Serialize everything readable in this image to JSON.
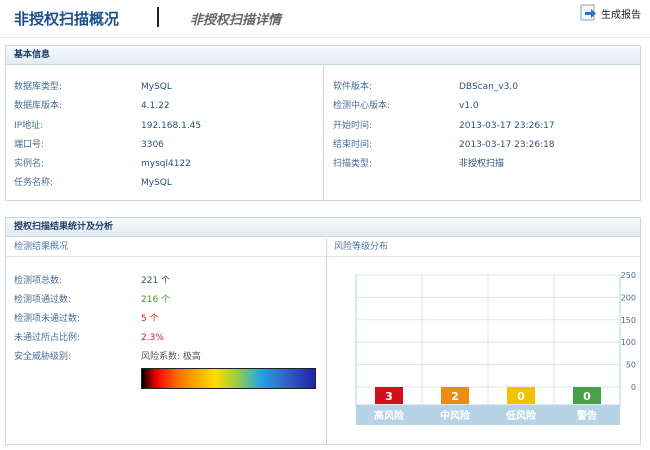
{
  "tabs": {
    "active": "非授权扫描概况",
    "inactive": "非授权扫描详情"
  },
  "toolbar": {
    "report_label": "生成报告"
  },
  "basic": {
    "title": "基本信息",
    "left": [
      {
        "label": "数据库类型:",
        "value": "MySQL"
      },
      {
        "label": "数据库版本:",
        "value": "4.1.22"
      },
      {
        "label": "IP地址:",
        "value": "192.168.1.45"
      },
      {
        "label": "端口号:",
        "value": "3306"
      },
      {
        "label": "实例名:",
        "value": "mysql4122"
      },
      {
        "label": "任务名称:",
        "value": "MySQL"
      }
    ],
    "right": [
      {
        "label": "软件版本:",
        "value": "DBScan_v3.0"
      },
      {
        "label": "检测中心版本:",
        "value": "v1.0"
      },
      {
        "label": "开始时间:",
        "value": "2013-03-17 23:26:17"
      },
      {
        "label": "结束时间:",
        "value": "2013-03-17 23:26:18"
      },
      {
        "label": "扫描类型:",
        "value": "非授权扫描"
      }
    ]
  },
  "analysis": {
    "title": "授权扫描结果统计及分析",
    "overview_title": "检测结果概况",
    "risk_title": "风险等级分布",
    "stats": [
      {
        "label": "检测项总数:",
        "value": "221 个"
      },
      {
        "label": "检测项通过数:",
        "value": "216 个"
      },
      {
        "label": "检测项未通过数:",
        "value": "5 个"
      },
      {
        "label": "未通过所占比例:",
        "value": "2.3%"
      },
      {
        "label": "安全威胁级别:",
        "value": "风险系数: 极高"
      }
    ],
    "colors": {
      "pass": "#3b9b2b",
      "fail": "#d42020"
    }
  },
  "chart_data": {
    "type": "bar",
    "categories": [
      "高风险",
      "中风险",
      "低风险",
      "警告"
    ],
    "values": [
      3,
      2,
      0,
      0
    ],
    "colors": [
      "#d0101a",
      "#ef8a12",
      "#f2c200",
      "#4aa04a"
    ],
    "ylim": [
      0,
      250
    ],
    "yticks": [
      "250",
      "200",
      "150",
      "100",
      "50",
      "0"
    ],
    "axis_position": "right",
    "grid": true
  }
}
